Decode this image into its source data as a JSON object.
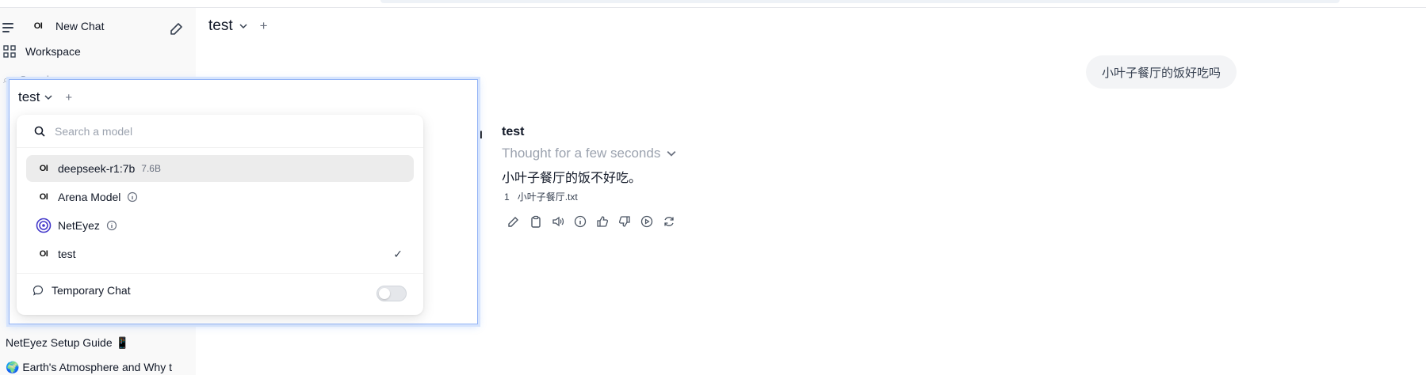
{
  "sidebar": {
    "new_chat_label": "New Chat",
    "workspace_label": "Workspace",
    "search_placeholder": "Search",
    "chats": [
      {
        "label": "NetEyez Setup Guide 📱"
      },
      {
        "label": "🌍 Earth's Atmosphere and Why t"
      }
    ]
  },
  "main": {
    "model_title": "test",
    "user_message": "小叶子餐厅的饭好吃吗",
    "assistant": {
      "name": "test",
      "thought_label": "Thought for a few seconds",
      "answer": "小叶子餐厅的饭不好吃。",
      "citation_index": "1",
      "citation_file": "小叶子餐厅.txt"
    }
  },
  "popup": {
    "title": "test",
    "search_placeholder": "Search a model",
    "models": [
      {
        "name": "deepseek-r1:7b",
        "size": "7.6B",
        "icon": "openwebui-logo",
        "highlighted": true
      },
      {
        "name": "Arena Model",
        "icon": "openwebui-logo",
        "info": true
      },
      {
        "name": "NetEyez",
        "icon": "neteyez-logo",
        "info": true
      },
      {
        "name": "test",
        "icon": "openwebui-logo",
        "checked": true
      }
    ],
    "temporary_chat_label": "Temporary Chat",
    "temporary_chat_enabled": false
  },
  "colors": {
    "accent_border": "#93b4f6",
    "sidebar_bg": "#f9f9f9",
    "bubble_bg": "#f3f4f6",
    "highlight_bg": "#ececec"
  }
}
